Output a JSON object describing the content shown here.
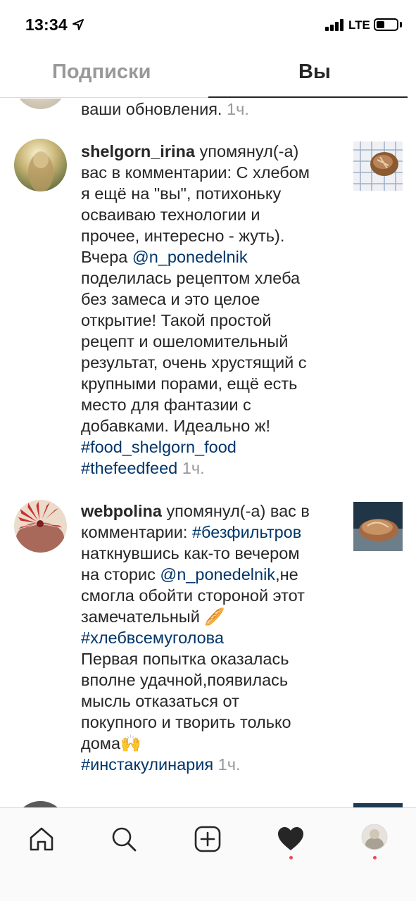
{
  "status": {
    "time": "13:34",
    "network": "LTE"
  },
  "tabs": {
    "following": "Подписки",
    "you": "Вы"
  },
  "feed": {
    "partial_top": {
      "text": "ваши обновления.",
      "time": "1ч."
    },
    "item1": {
      "username": "shelgorn_irina",
      "action": " упомянул(-а)",
      "l2": "вас в комментарии: С хлебом",
      "l3": "я ещё на \"вы\", потихоньку",
      "l4": "осваиваю технологии и",
      "l5": "прочее, интересно - жуть).",
      "l6_pre": "Вчера ",
      "l6_mention": "@n_ponedelnik",
      "l7": "поделилась рецептом хлеба",
      "l8": "без замеса и это целое",
      "l9": "открытие! Такой простой",
      "l10": "рецепт и ошеломительный",
      "l11": "результат, очень хрустящий с",
      "l12": "крупными порами, ещё есть",
      "l13": "место для фантазии с",
      "l14": "добавками. Идеально ж!",
      "l15": "#food_shelgorn_food",
      "l16": "#thefeedfeed",
      "time": "1ч."
    },
    "item2": {
      "username": "webpolina",
      "action": " упомянул(-а) вас в",
      "l2_pre": "комментарии: ",
      "l2_tag": "#безфильтров",
      "l3": "наткнувшись как-то вечером",
      "l4_pre": "на сторис ",
      "l4_mention": "@n_ponedelnik",
      "l4_post": ",не",
      "l5": "смогла обойти стороной этот",
      "l6": "замечательный 🥖",
      "l7": "#хлебвсемуголова",
      "l8": "Первая попытка оказалась",
      "l9": "вполне удачной,появилась",
      "l10": "мысль отказаться от",
      "l11": "покупного и творить только",
      "l12": "дома🙌",
      "l13": "#инстакулинария",
      "time": "1ч."
    }
  },
  "nav": {
    "icons": [
      "home-icon",
      "search-icon",
      "add-post-icon",
      "activity-heart-icon",
      "profile-avatar"
    ]
  },
  "colors": {
    "link": "#003569",
    "muted": "#999999",
    "text": "#262626",
    "notification_dot": "#ed4956"
  }
}
